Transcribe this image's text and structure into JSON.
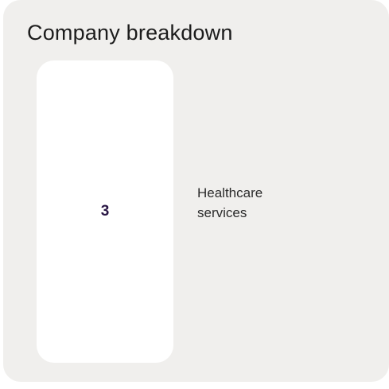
{
  "card": {
    "title": "Company breakdown",
    "stat": {
      "value": "3",
      "label_line1": "Healthcare",
      "label_line2": "services"
    }
  },
  "colors": {
    "card_background": "#f0efed",
    "tile_background": "#ffffff",
    "value_color": "#2a1745",
    "text_color": "#2b2b2b"
  }
}
